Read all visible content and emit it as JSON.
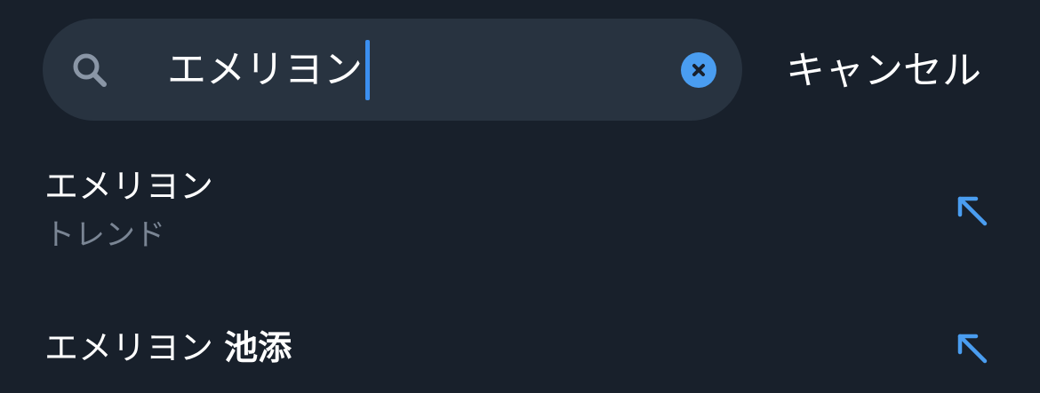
{
  "search": {
    "query": "エメリヨン",
    "cancel_label": "キャンセル"
  },
  "icons": {
    "search": "search-icon",
    "clear": "clear-x-circle-icon",
    "fill_query": "arrow-up-left-icon"
  },
  "colors": {
    "background": "#18202b",
    "search_field": "#283340",
    "accent": "#4a9df0",
    "secondary_text": "#7a8594"
  },
  "suggestions": [
    {
      "title": "エメリヨン",
      "subtitle": "トレンド"
    },
    {
      "title_prefix": "エメリヨン ",
      "title_bold": "池添"
    }
  ]
}
